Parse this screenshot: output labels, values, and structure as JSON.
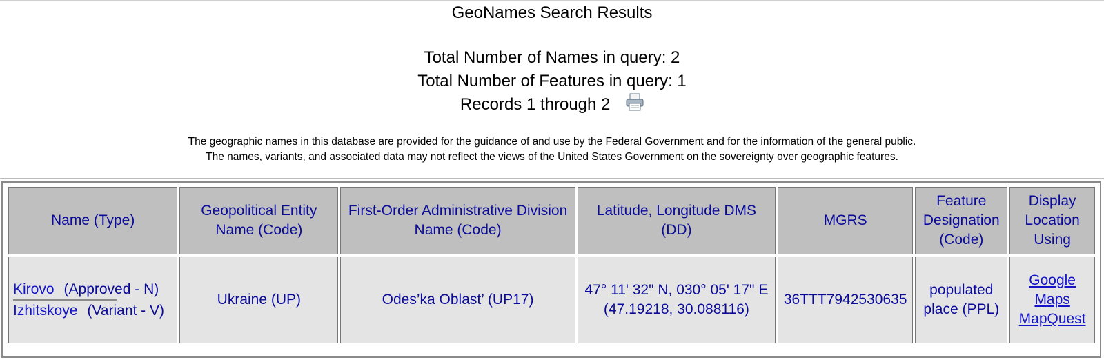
{
  "page": {
    "title": "GeoNames Search Results",
    "total_names": "Total Number of Names in query: 2",
    "total_features": "Total Number of Features in query: 1",
    "records": "Records 1 through 2"
  },
  "icons": {
    "print": "printer-icon"
  },
  "disclaimer": {
    "line1": "The geographic names in this database are provided for the guidance of and use by the Federal Government and for the information of the general public.",
    "line2": "The names, variants, and associated data may not reflect the views of the United States Government on the sovereignty over geographic features."
  },
  "table": {
    "headers": {
      "name": "Name (Type)",
      "entity": "Geopolitical Entity Name (Code)",
      "adm1": "First-Order Administrative Division Name (Code)",
      "latlon": "Latitude, Longitude DMS (DD)",
      "mgrs": "MGRS",
      "feature": "Feature Designation (Code)",
      "display": "Display Location Using"
    },
    "row": {
      "names": [
        {
          "name": "Kirovo",
          "type": "(Approved - N)"
        },
        {
          "name": "Izhitskoye",
          "type": "(Variant - V)"
        }
      ],
      "entity": "Ukraine (UP)",
      "adm1": "Odes’ka Oblast’ (UP17)",
      "dms": "47° 11' 32\" N, 030° 05' 17\" E",
      "dd": "(47.19218, 30.088116)",
      "mgrs": "36TTT7942530635",
      "feature": "populated place (PPL)",
      "links": {
        "google": "Google Maps",
        "mapquest": "MapQuest"
      }
    }
  },
  "colors": {
    "header_bg": "#bfbfbf",
    "cell_bg": "#e4e4e4",
    "text_blue": "#0b0b9a",
    "link_blue": "#1414c8"
  }
}
